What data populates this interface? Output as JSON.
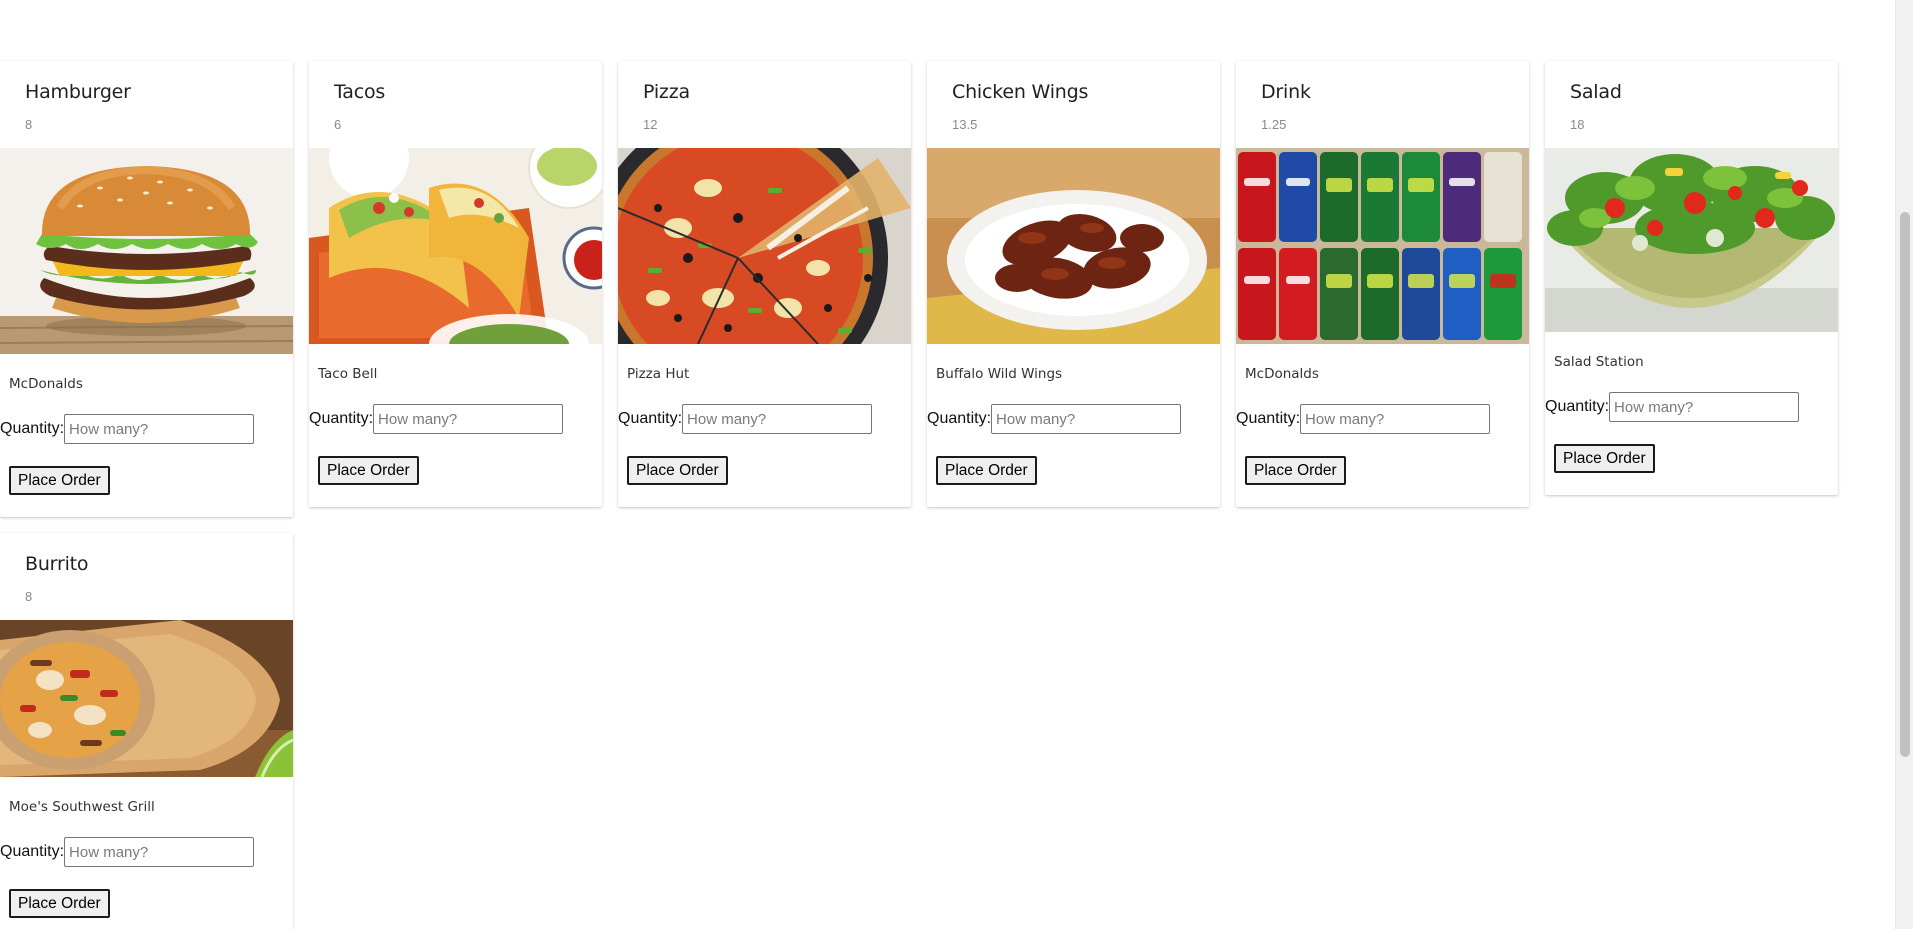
{
  "products": [
    {
      "name": "Hamburger",
      "price": "8",
      "vendor": "McDonalds",
      "quantity_label": "Quantity:",
      "quantity_placeholder": "How many?",
      "button_label": "Place Order",
      "image": "burger"
    },
    {
      "name": "Tacos",
      "price": "6",
      "vendor": "Taco Bell",
      "quantity_label": "Quantity:",
      "quantity_placeholder": "How many?",
      "button_label": "Place Order",
      "image": "tacos"
    },
    {
      "name": "Pizza",
      "price": "12",
      "vendor": "Pizza Hut",
      "quantity_label": "Quantity:",
      "quantity_placeholder": "How many?",
      "button_label": "Place Order",
      "image": "pizza"
    },
    {
      "name": "Chicken Wings",
      "price": "13.5",
      "vendor": "Buffalo Wild Wings",
      "quantity_label": "Quantity:",
      "quantity_placeholder": "How many?",
      "button_label": "Place Order",
      "image": "wings"
    },
    {
      "name": "Drink",
      "price": "1.25",
      "vendor": "McDonalds",
      "quantity_label": "Quantity:",
      "quantity_placeholder": "How many?",
      "button_label": "Place Order",
      "image": "drink"
    },
    {
      "name": "Salad",
      "price": "18",
      "vendor": "Salad Station",
      "quantity_label": "Quantity:",
      "quantity_placeholder": "How many?",
      "button_label": "Place Order",
      "image": "salad"
    },
    {
      "name": "Burrito",
      "price": "8",
      "vendor": "Moe's Southwest Grill",
      "quantity_label": "Quantity:",
      "quantity_placeholder": "How many?",
      "button_label": "Place Order",
      "image": "burrito"
    }
  ]
}
